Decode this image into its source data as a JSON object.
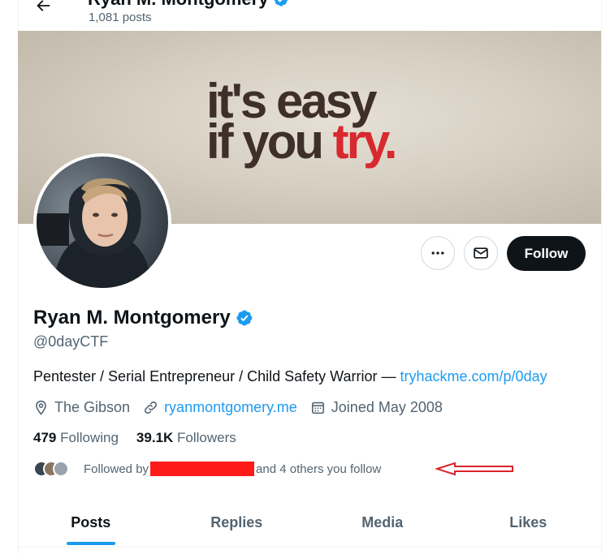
{
  "header": {
    "name": "Ryan M. Montgomery",
    "posts_count": "1,081 posts"
  },
  "banner": {
    "line1": "it's easy",
    "line2_start": "if you ",
    "line2_red": "try."
  },
  "profile": {
    "display_name": "Ryan M. Montgomery",
    "handle": "@0dayCTF",
    "bio_text": "Pentester / Serial Entrepreneur / Child Safety Warrior — ",
    "bio_link": "tryhackme.com/p/0day",
    "location": "The Gibson",
    "website": "ryanmontgomery.me",
    "joined": "Joined May 2008",
    "following_count": "479",
    "following_label": "Following",
    "followers_count": "39.1K",
    "followers_label": "Followers",
    "followed_by_prefix": "Followed by",
    "followed_by_suffix": "and 4 others you follow"
  },
  "actions": {
    "follow_label": "Follow"
  },
  "tabs": [
    {
      "label": "Posts",
      "active": true
    },
    {
      "label": "Replies",
      "active": false
    },
    {
      "label": "Media",
      "active": false
    },
    {
      "label": "Likes",
      "active": false
    }
  ],
  "colors": {
    "accent": "#1d9bf0",
    "text": "#0f1419",
    "muted": "#536471",
    "redaction": "#ff1a1a"
  },
  "icons": [
    "back-arrow-icon",
    "verified-badge-icon",
    "more-icon",
    "message-icon",
    "location-icon",
    "link-icon",
    "calendar-icon"
  ]
}
